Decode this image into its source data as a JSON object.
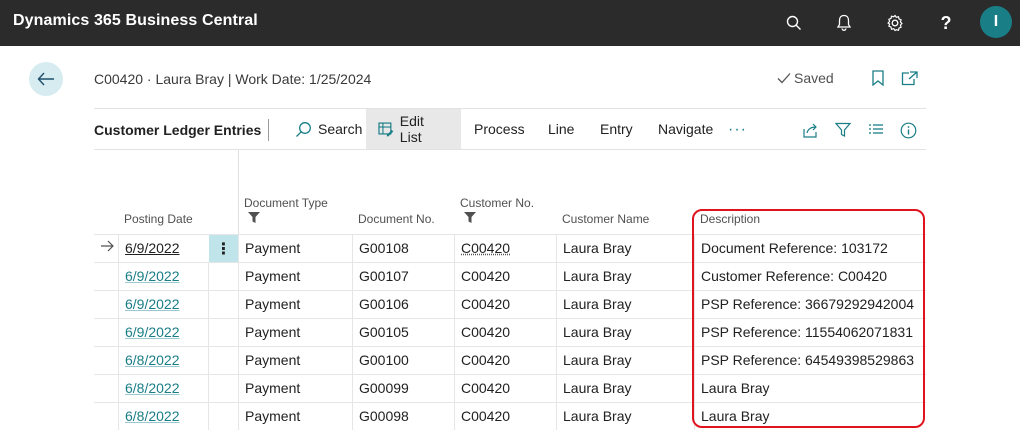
{
  "app": {
    "title": "Dynamics 365 Business Central",
    "avatar_initial": "I",
    "accent": "#1a7e87"
  },
  "topbar_icons": [
    "search-icon",
    "bell-icon",
    "gear-icon",
    "help-icon"
  ],
  "header": {
    "breadcrumb": "C00420 · Laura Bray | Work Date: 1/25/2024",
    "saved_label": "Saved"
  },
  "actionbar": {
    "caption": "Customer Ledger Entries",
    "search_label": "Search",
    "edit_list_label": "Edit List",
    "process_label": "Process",
    "line_label": "Line",
    "entry_label": "Entry",
    "navigate_label": "Navigate",
    "more_label": "···"
  },
  "table": {
    "columns": {
      "posting_date": "Posting Date",
      "document_type": "Document Type",
      "document_no": "Document No.",
      "customer_no": "Customer No.",
      "customer_name": "Customer Name",
      "description": "Description"
    },
    "rows": [
      {
        "posting_date": "6/9/2022",
        "document_type": "Payment",
        "document_no": "G00108",
        "customer_no": "C00420",
        "customer_name": "Laura Bray",
        "description": "Document Reference: 103172"
      },
      {
        "posting_date": "6/9/2022",
        "document_type": "Payment",
        "document_no": "G00107",
        "customer_no": "C00420",
        "customer_name": "Laura Bray",
        "description": "Customer Reference: C00420"
      },
      {
        "posting_date": "6/9/2022",
        "document_type": "Payment",
        "document_no": "G00106",
        "customer_no": "C00420",
        "customer_name": "Laura Bray",
        "description": "PSP Reference: 36679292942004"
      },
      {
        "posting_date": "6/9/2022",
        "document_type": "Payment",
        "document_no": "G00105",
        "customer_no": "C00420",
        "customer_name": "Laura Bray",
        "description": "PSP Reference: 11554062071831"
      },
      {
        "posting_date": "6/8/2022",
        "document_type": "Payment",
        "document_no": "G00100",
        "customer_no": "C00420",
        "customer_name": "Laura Bray",
        "description": "PSP Reference: 64549398529863"
      },
      {
        "posting_date": "6/8/2022",
        "document_type": "Payment",
        "document_no": "G00099",
        "customer_no": "C00420",
        "customer_name": "Laura Bray",
        "description": "Laura Bray"
      },
      {
        "posting_date": "6/8/2022",
        "document_type": "Payment",
        "document_no": "G00098",
        "customer_no": "C00420",
        "customer_name": "Laura Bray",
        "description": "Laura Bray"
      }
    ]
  }
}
